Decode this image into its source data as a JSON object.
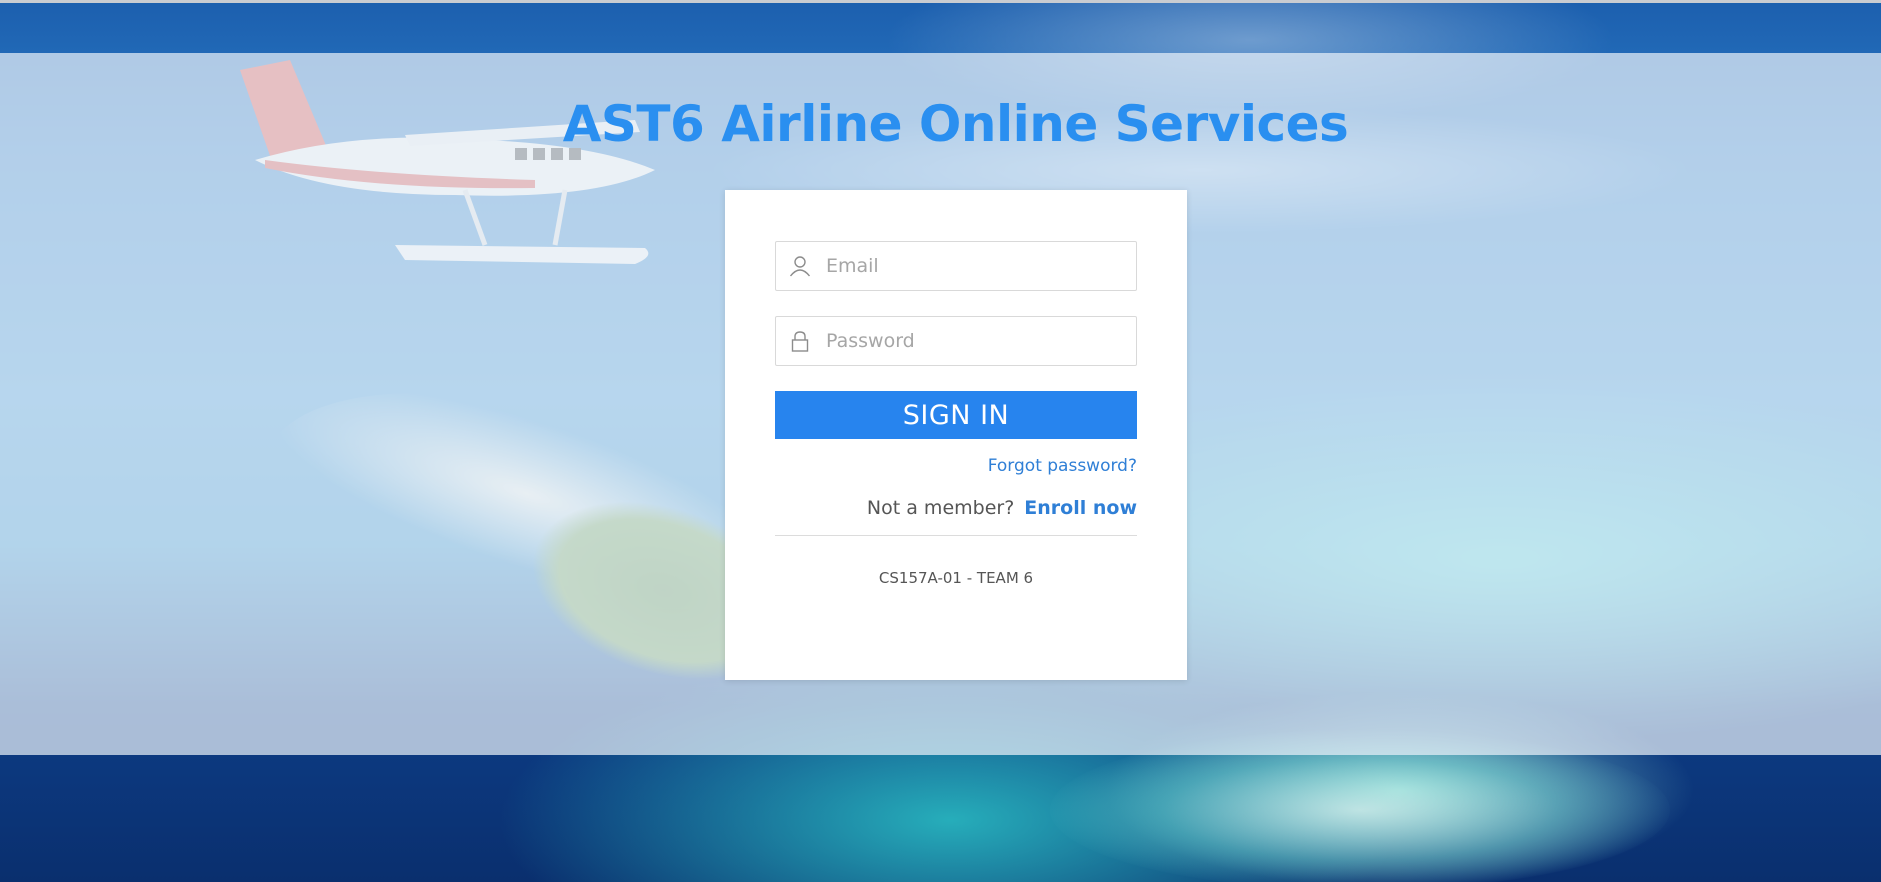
{
  "page": {
    "title": "AST6 Airline Online Services"
  },
  "login": {
    "email_placeholder": "Email",
    "password_placeholder": "Password",
    "sign_in_label": "SIGN IN",
    "forgot_password_label": "Forgot password?",
    "not_member_label": "Not a member?",
    "enroll_label": "Enroll now",
    "footer_note": "CS157A-01 - TEAM 6"
  },
  "icons": {
    "email": "user-icon",
    "password": "lock-icon"
  },
  "colors": {
    "title": "#2a8ff0",
    "primary_button": "#2784ee",
    "link": "#2f7fd6",
    "card_background": "#ffffff"
  }
}
